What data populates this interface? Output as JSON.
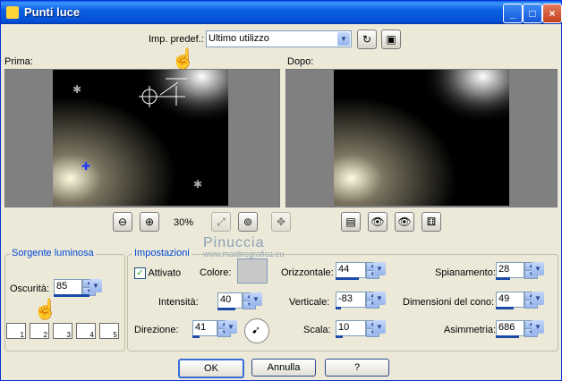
{
  "window": {
    "title": "Punti luce"
  },
  "titlebar": {
    "min": "_",
    "max": "□",
    "close": "×"
  },
  "preset": {
    "label": "Imp. predef.:",
    "value": "Ultimo utilizzo"
  },
  "panes": {
    "before_label": "Prima:",
    "after_label": "Dopo:"
  },
  "zoom": {
    "value": "30%"
  },
  "watermark": {
    "line1": "Pinuccia",
    "line2": "www.maidiregrafica.eu"
  },
  "light_source": {
    "legend": "Sorgente luminosa",
    "darkness_label": "Oscurità:",
    "darkness_value": "85",
    "presets": [
      "1",
      "2",
      "3",
      "4",
      "5"
    ]
  },
  "settings": {
    "legend": "Impostazioni",
    "enabled_label": "Attivato",
    "color_label": "Colore:",
    "color_value": "#c8c8c8",
    "intensity_label": "Intensità:",
    "intensity_value": "40",
    "direction_label": "Direzione:",
    "direction_value": "41",
    "horizontal_label": "Orizzontale:",
    "horizontal_value": "44",
    "vertical_label": "Verticale:",
    "vertical_value": "-83",
    "scale_label": "Scala:",
    "scale_value": "10",
    "smoothing_label": "Spianamento:",
    "smoothing_value": "28",
    "cone_label": "Dimensioni del cono:",
    "cone_value": "49",
    "asymmetry_label": "Asimmetria:",
    "asymmetry_value": "686"
  },
  "buttons": {
    "ok": "OK",
    "cancel": "Annulla",
    "help": "?"
  }
}
